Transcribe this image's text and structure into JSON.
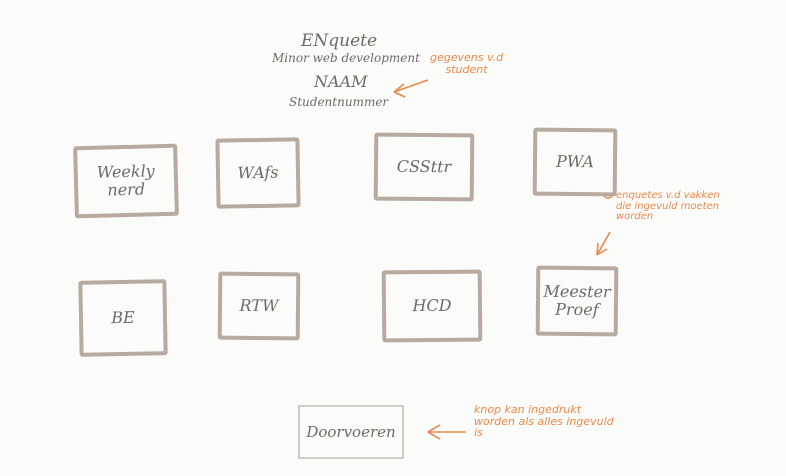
{
  "header": {
    "title": "ENquete",
    "subtitle": "Minor web development",
    "name_label": "NAAM",
    "student_number_label": "Studentnummer"
  },
  "annotations": {
    "student_info": "gegevens v.d\nstudent",
    "subjects": "enquetes v.d vakken\ndie ingevuld moeten\nworden",
    "submit": "knop kan ingedrukt\nworden als alles ingevuld\nis"
  },
  "subjects": {
    "row1": [
      "Weekly\nnerd",
      "WAfs",
      "CSSttr",
      "PWA"
    ],
    "row2": [
      "BE",
      "RTW",
      "HCD",
      "Meester\nProef"
    ]
  },
  "submit_button": {
    "label": "Doorvoeren"
  },
  "colors": {
    "pen_gray": "#6f6a66",
    "box_border": "#b7aaa0",
    "annotation_orange": "#e9894a"
  }
}
